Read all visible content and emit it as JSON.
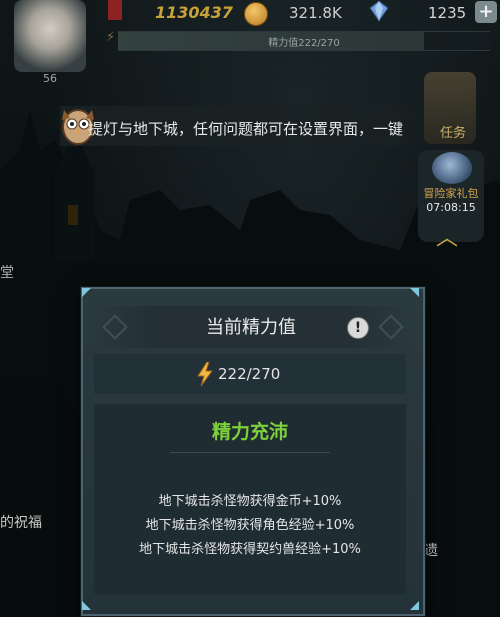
{
  "top_bar": {
    "power": "1130437",
    "gold": "321.8K",
    "gems": "1235",
    "plus_label": "+"
  },
  "stamina_bar": {
    "label": "精力值222/270",
    "fill_fraction": 0.822
  },
  "player": {
    "level": "56"
  },
  "tip": {
    "text": "提灯与地下城，任何问题都可在设置界面，一键"
  },
  "quest": {
    "label": "任务"
  },
  "gift_pack": {
    "name": "冒险家礼包",
    "timer": "07:08:15"
  },
  "side_labels": {
    "left_top": "堂",
    "left_bottom": "的祝福",
    "right_bottom": "遗"
  },
  "dialog": {
    "title": "当前精力值",
    "info_label": "!",
    "stamina_value": "222/270",
    "status": "精力充沛",
    "bonuses": [
      "地下城击杀怪物获得金币+10%",
      "地下城击杀怪物获得角色经验+10%",
      "地下城击杀怪物获得契约兽经验+10%"
    ]
  },
  "colors": {
    "status_green": "#7ed13a",
    "corner_accent": "#7fc8de",
    "power_gold": "#c7a13a"
  }
}
